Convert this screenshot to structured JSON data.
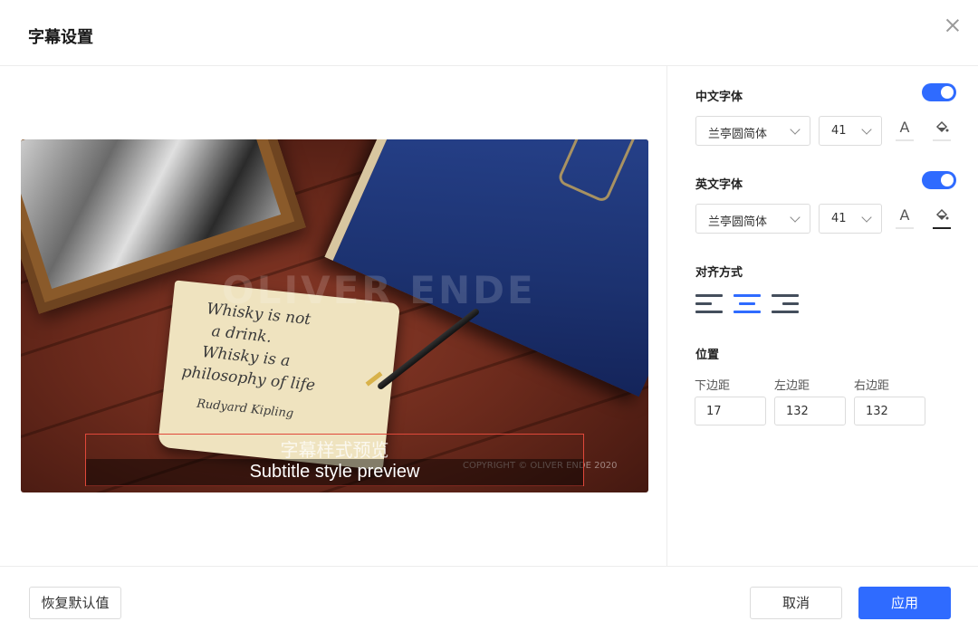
{
  "dialog": {
    "title": "字幕设置"
  },
  "preview": {
    "paper_lines": [
      "Whisky is not",
      "a drink.",
      "Whisky is a",
      "philosophy of life"
    ],
    "signature": "Rudyard Kipling",
    "watermark": "OLIVER ENDE",
    "copyright": "COPYRIGHT © OLIVER ENDE 2020",
    "subtitle_cn": "字幕样式预览",
    "subtitle_en": "Subtitle style preview"
  },
  "chinese_font": {
    "label": "中文字体",
    "enabled": true,
    "font": "兰亭圆简体",
    "size": "41",
    "text_color_icon": "A",
    "bg_color_icon": "fill-bucket-icon"
  },
  "english_font": {
    "label": "英文字体",
    "enabled": true,
    "font": "兰亭圆简体",
    "size": "41",
    "text_color_icon": "A",
    "bg_color_icon": "fill-bucket-icon"
  },
  "alignment": {
    "label": "对齐方式",
    "options": [
      "left",
      "center",
      "right"
    ],
    "selected": "center"
  },
  "position": {
    "label": "位置",
    "bottom": {
      "label": "下边距",
      "value": "17"
    },
    "left": {
      "label": "左边距",
      "value": "132"
    },
    "right": {
      "label": "右边距",
      "value": "132"
    }
  },
  "footer": {
    "reset_label": "恢复默认值",
    "cancel_label": "取消",
    "apply_label": "应用"
  },
  "colors": {
    "accent": "#2f6bff",
    "subtitle_box": "#e0483a"
  }
}
